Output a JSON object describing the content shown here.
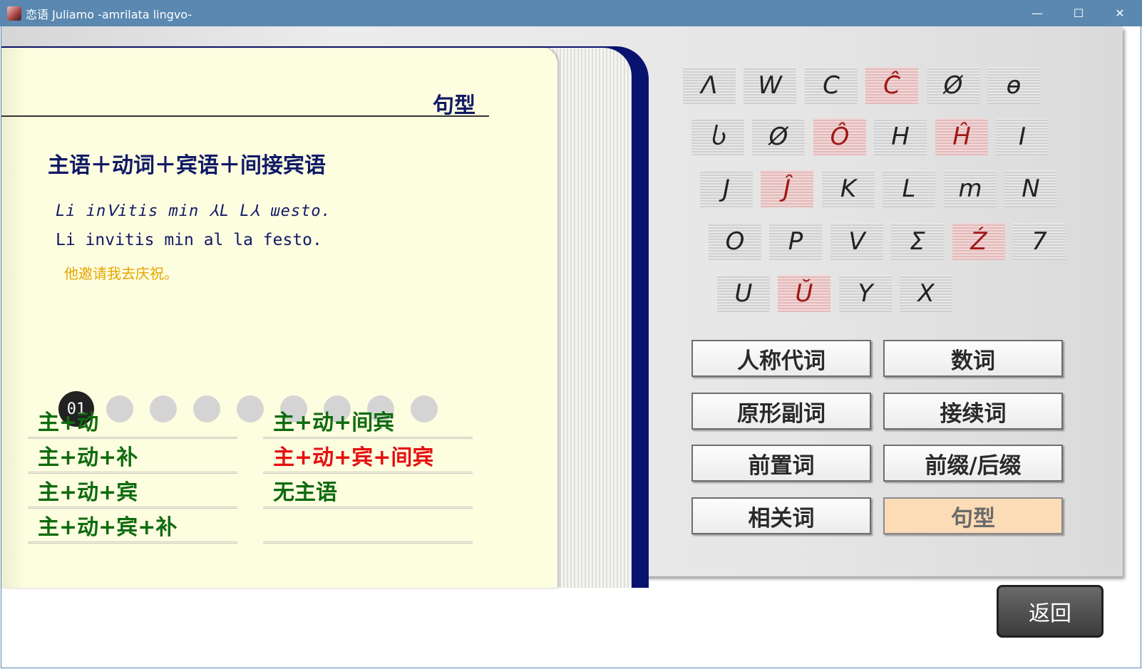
{
  "window": {
    "title": "恋语 Juliamo -amrilata lingvo-",
    "minimize_glyph": "—",
    "maximize_glyph": "☐",
    "close_glyph": "✕"
  },
  "page": {
    "title": "句型",
    "pattern_heading": "主语＋动词＋宾语＋间接宾语",
    "example_script": "Li inⅤitis min ⅄L L⅄ ɯesto.",
    "example_latin": "Li invitis min al la festo.",
    "example_translation": "他邀请我去庆祝。"
  },
  "pagination": {
    "current": "01",
    "total_dots": 9
  },
  "patterns": {
    "left": [
      "主+动",
      "主+动+补",
      "主+动+宾",
      "主+动+宾+补"
    ],
    "right": [
      "主+动+间宾",
      "主+动+宾+间宾",
      "无主语",
      ""
    ],
    "current_index_right": 1
  },
  "letters": {
    "row1": [
      "Λ",
      "W",
      "C",
      "Ĉ",
      "Ø",
      "ɵ"
    ],
    "row2": [
      "Ⴑ",
      "Ø",
      "Ô",
      "H",
      "Ĥ",
      "I"
    ],
    "row3": [
      "J",
      "Ĵ",
      "K",
      "L",
      "m",
      "N"
    ],
    "row4": [
      "O",
      "P",
      "V",
      "Σ",
      "Ź",
      "7"
    ],
    "row5": [
      "U",
      "Ŭ",
      "Y",
      "X"
    ],
    "red": [
      "Ĉ",
      "Ô",
      "Ĥ",
      "Ĵ",
      "Ź",
      "Ŭ"
    ]
  },
  "categories": {
    "pronouns": "人称代词",
    "numerals": "数词",
    "adverbs": "原形副词",
    "conjunctions": "接续词",
    "prepositions": "前置词",
    "affixes": "前缀/后缀",
    "correlatives": "相关词",
    "sentence_patterns": "句型",
    "selected": "句型"
  },
  "back_label": "返回",
  "colors": {
    "titlebar": "#5a88b0",
    "book_cover": "#0a1270",
    "page": "#fdfde0",
    "pattern_link": "#0f6b0f",
    "pattern_current": "#e51010",
    "translation": "#e5a600",
    "selected_button": "#fbdcb6"
  }
}
